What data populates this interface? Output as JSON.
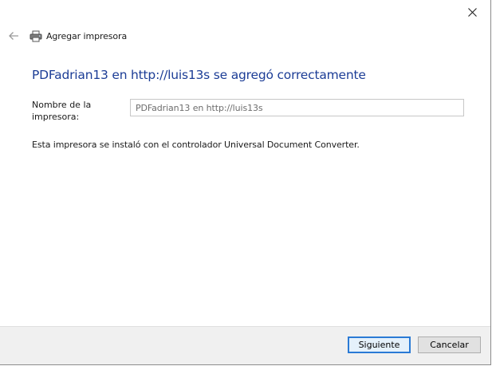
{
  "window": {
    "title": "Agregar impresora",
    "close_glyph": "✕"
  },
  "nav": {
    "back_icon": "back-arrow-icon",
    "printer_icon": "printer-icon"
  },
  "main": {
    "heading": "PDFadrian13 en http://luis13s se agregó correctamente",
    "name_label": "Nombre de la impresora:",
    "name_value": "PDFadrian13 en http://luis13s",
    "info": "Esta impresora se instaló con el controlador Universal Document Converter."
  },
  "footer": {
    "next_label": "Siguiente",
    "cancel_label": "Cancelar"
  },
  "colors": {
    "heading": "#1c3d96",
    "default_button_border": "#2a7ad5",
    "footer_bg": "#f0f0f0"
  }
}
